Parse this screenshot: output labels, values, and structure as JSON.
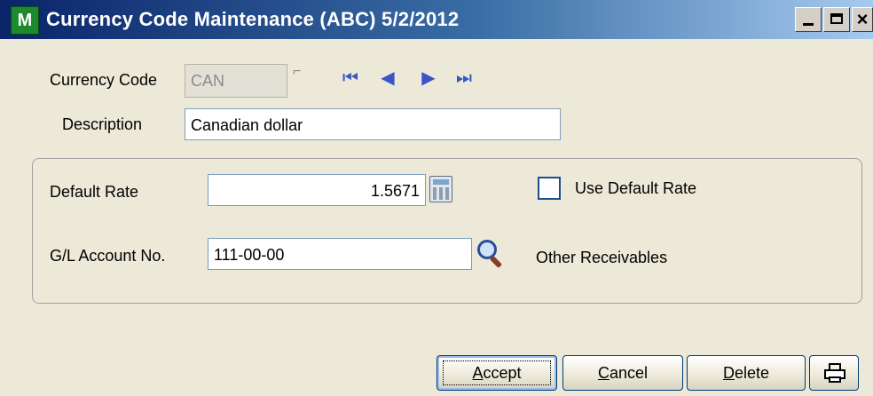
{
  "window": {
    "title": "Currency Code Maintenance (ABC) 5/2/2012",
    "app_icon_letter": "M",
    "title_gradient": [
      "#0a246a",
      "#a6caf0"
    ],
    "min_glyph": "minimize-icon",
    "max_glyph": "maximize-icon",
    "close_glyph": "×"
  },
  "header": {
    "currency_code_label": "Currency Code",
    "currency_code_value": "CAN",
    "description_label": "Description",
    "description_value": "Canadian dollar",
    "nav": {
      "first": "⏮",
      "prev": "◀",
      "next": "▶",
      "last": "⏭"
    }
  },
  "rate_group": {
    "default_rate_label": "Default Rate",
    "default_rate_value": "1.5671",
    "use_default_rate_label": "Use Default Rate",
    "use_default_rate_checked": false,
    "gl_account_label": "G/L Account No.",
    "gl_account_value": "111-00-00",
    "gl_account_description": "Other Receivables"
  },
  "buttons": {
    "accept_first": "A",
    "accept_rest": "ccept",
    "cancel_first": "C",
    "cancel_rest": "ancel",
    "delete_first": "D",
    "delete_rest": "elete",
    "print_icon": "printer-icon"
  }
}
